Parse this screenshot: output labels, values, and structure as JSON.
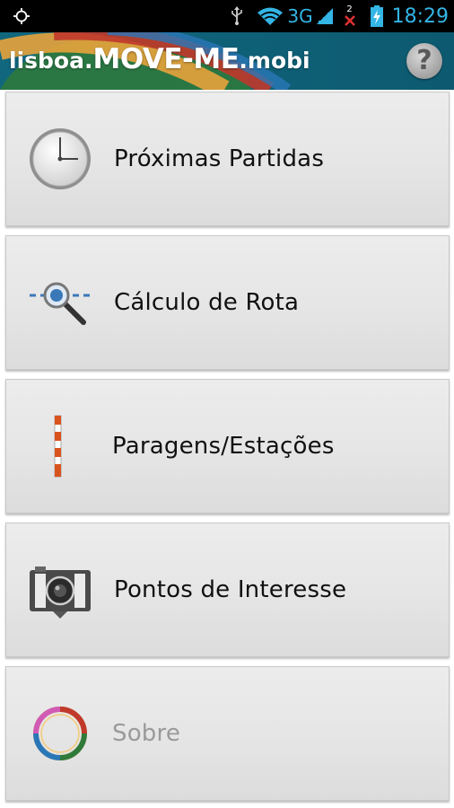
{
  "status_bar": {
    "network_label": "3G",
    "notification_count": "2",
    "time": "18:29",
    "icons": [
      "gps-icon",
      "usb-icon",
      "wifi-icon",
      "signal-icon",
      "no-sim-icon",
      "battery-charging-icon"
    ],
    "accent_color": "#33b5e5"
  },
  "header": {
    "logo_prefix": "lisboa.",
    "logo_main": "MOVE-ME",
    "logo_suffix": ".mobi",
    "help_label": "?",
    "colors": {
      "background": "#0e5c73",
      "arc_red": "#c0392b",
      "arc_orange": "#e8a33c"
    }
  },
  "menu": {
    "items": [
      {
        "label": "Próximas Partidas",
        "icon": "clock-icon",
        "enabled": true
      },
      {
        "label": "Cálculo de Rota",
        "icon": "route-search-icon",
        "enabled": true
      },
      {
        "label": "Paragens/Estações",
        "icon": "stop-pole-icon",
        "enabled": true
      },
      {
        "label": "Pontos de Interesse",
        "icon": "camera-icon",
        "enabled": true
      },
      {
        "label": "Sobre",
        "icon": "ring-logo-icon",
        "enabled": false
      }
    ]
  }
}
